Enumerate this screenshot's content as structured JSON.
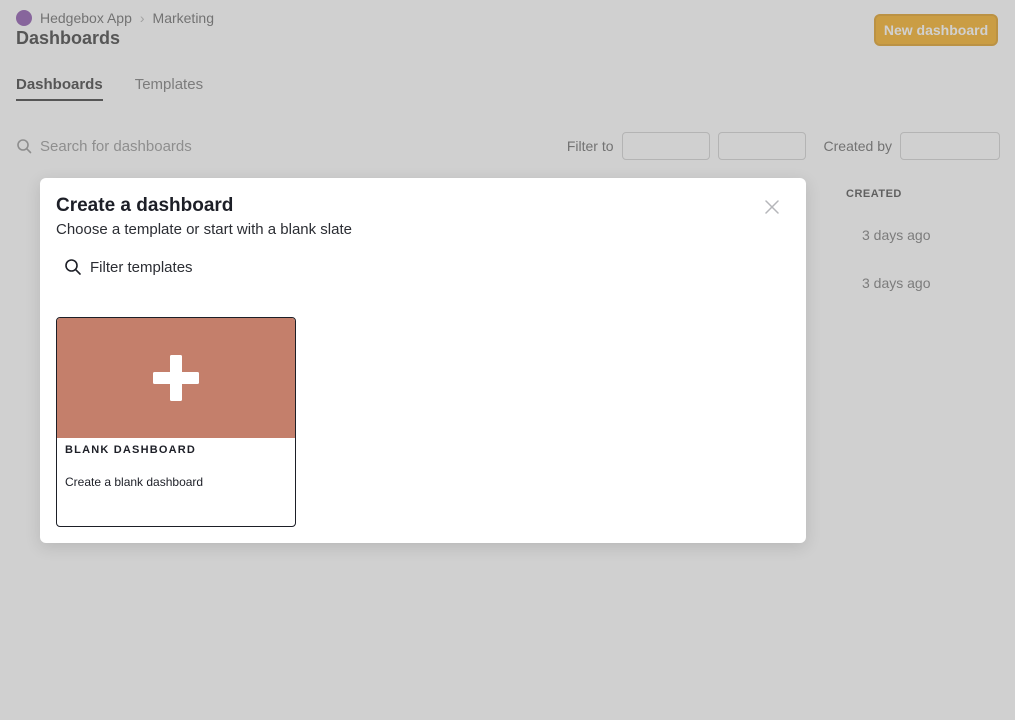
{
  "background": {
    "breadcrumb": [
      "Hedgebox App",
      "Marketing"
    ],
    "page_title": "Dashboards",
    "new_button_label": "New dashboard",
    "tabs": [
      "Dashboards",
      "Templates"
    ],
    "search_placeholder": "Search for dashboards",
    "filter_label": "Filter to",
    "created_by_label": "Created by",
    "table_header_created": "CREATED",
    "row_created": [
      "3 days ago",
      "3 days ago"
    ]
  },
  "modal": {
    "title": "Create a dashboard",
    "subtitle": "Choose a template or start with a blank slate",
    "filter_placeholder": "Filter templates",
    "templates": [
      {
        "name": "BLANK DASHBOARD",
        "description": "Create a blank dashboard",
        "icon": "plus-icon"
      }
    ]
  },
  "colors": {
    "template_thumbnail": "#c47f6b",
    "primary_button": "#f5a300",
    "overlay": "rgba(150,150,150,0.45)"
  }
}
